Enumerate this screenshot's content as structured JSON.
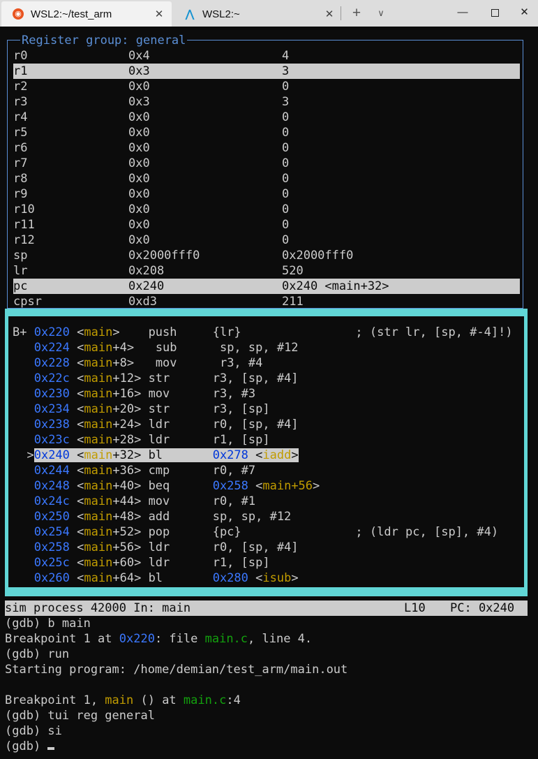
{
  "window": {
    "tabs": [
      {
        "title": "WSL2:~/test_arm",
        "close": "✕"
      },
      {
        "title": "WSL2:~",
        "close": "✕"
      }
    ],
    "new_tab": "+",
    "dropdown": "∨",
    "minimize": "—",
    "close": "✕"
  },
  "regs": {
    "title": "Register group: general",
    "rows": [
      {
        "name": "r0",
        "hex": "0x4",
        "val": "4"
      },
      {
        "name": "r1",
        "hex": "0x3",
        "val": "3"
      },
      {
        "name": "r2",
        "hex": "0x0",
        "val": "0"
      },
      {
        "name": "r3",
        "hex": "0x3",
        "val": "3"
      },
      {
        "name": "r4",
        "hex": "0x0",
        "val": "0"
      },
      {
        "name": "r5",
        "hex": "0x0",
        "val": "0"
      },
      {
        "name": "r6",
        "hex": "0x0",
        "val": "0"
      },
      {
        "name": "r7",
        "hex": "0x0",
        "val": "0"
      },
      {
        "name": "r8",
        "hex": "0x0",
        "val": "0"
      },
      {
        "name": "r9",
        "hex": "0x0",
        "val": "0"
      },
      {
        "name": "r10",
        "hex": "0x0",
        "val": "0"
      },
      {
        "name": "r11",
        "hex": "0x0",
        "val": "0"
      },
      {
        "name": "r12",
        "hex": "0x0",
        "val": "0"
      },
      {
        "name": "sp",
        "hex": "0x2000fff0",
        "val": "0x2000fff0"
      },
      {
        "name": "lr",
        "hex": "0x208",
        "val": "520"
      },
      {
        "name": "pc",
        "hex": "0x240",
        "val": "0x240 <main+32>"
      },
      {
        "name": "cpsr",
        "hex": "0xd3",
        "val": "211"
      }
    ]
  },
  "asm": {
    "rows": [
      {
        "prefix": "B+ ",
        "addr": "0x220",
        "sym": "main",
        "off": "",
        "pad": "   ",
        "op": "push",
        "args": "{lr}",
        "args_addr": "",
        "args_sym": "",
        "comment": "                ; (str lr, [sp, #-4]!)"
      },
      {
        "prefix": "   ",
        "addr": "0x224",
        "sym": "main",
        "off": "+4",
        "pad": " ",
        "op": "sub ",
        "args": "sp, sp, #12",
        "args_addr": "",
        "args_sym": "",
        "comment": ""
      },
      {
        "prefix": "   ",
        "addr": "0x228",
        "sym": "main",
        "off": "+8",
        "pad": " ",
        "op": "mov ",
        "args": "r3, #4",
        "args_addr": "",
        "args_sym": "",
        "comment": ""
      },
      {
        "prefix": "   ",
        "addr": "0x22c",
        "sym": "main",
        "off": "+12",
        "pad": "",
        "op": "str ",
        "args": "r3, [sp, #4]",
        "args_addr": "",
        "args_sym": "",
        "comment": ""
      },
      {
        "prefix": "   ",
        "addr": "0x230",
        "sym": "main",
        "off": "+16",
        "pad": "",
        "op": "mov ",
        "args": "r3, #3",
        "args_addr": "",
        "args_sym": "",
        "comment": ""
      },
      {
        "prefix": "   ",
        "addr": "0x234",
        "sym": "main",
        "off": "+20",
        "pad": "",
        "op": "str ",
        "args": "r3, [sp]",
        "args_addr": "",
        "args_sym": "",
        "comment": ""
      },
      {
        "prefix": "   ",
        "addr": "0x238",
        "sym": "main",
        "off": "+24",
        "pad": "",
        "op": "ldr ",
        "args": "r0, [sp, #4]",
        "args_addr": "",
        "args_sym": "",
        "comment": ""
      },
      {
        "prefix": "   ",
        "addr": "0x23c",
        "sym": "main",
        "off": "+28",
        "pad": "",
        "op": "ldr ",
        "args": "r1, [sp]",
        "args_addr": "",
        "args_sym": "",
        "comment": ""
      },
      {
        "prefix": "  >",
        "addr": "0x240",
        "sym": "main",
        "off": "+32",
        "pad": "",
        "op": "bl  ",
        "args": "",
        "args_addr": "0x278",
        "args_sym": "iadd",
        "comment": "",
        "current": true
      },
      {
        "prefix": "   ",
        "addr": "0x244",
        "sym": "main",
        "off": "+36",
        "pad": "",
        "op": "cmp ",
        "args": "r0, #7",
        "args_addr": "",
        "args_sym": "",
        "comment": ""
      },
      {
        "prefix": "   ",
        "addr": "0x248",
        "sym": "main",
        "off": "+40",
        "pad": "",
        "op": "beq ",
        "args": "",
        "args_addr": "0x258",
        "args_sym": "main+56",
        "comment": ""
      },
      {
        "prefix": "   ",
        "addr": "0x24c",
        "sym": "main",
        "off": "+44",
        "pad": "",
        "op": "mov ",
        "args": "r0, #1",
        "args_addr": "",
        "args_sym": "",
        "comment": ""
      },
      {
        "prefix": "   ",
        "addr": "0x250",
        "sym": "main",
        "off": "+48",
        "pad": "",
        "op": "add ",
        "args": "sp, sp, #12",
        "args_addr": "",
        "args_sym": "",
        "comment": ""
      },
      {
        "prefix": "   ",
        "addr": "0x254",
        "sym": "main",
        "off": "+52",
        "pad": "",
        "op": "pop ",
        "args": "{pc}",
        "args_addr": "",
        "args_sym": "",
        "comment": "                ; (ldr pc, [sp], #4)"
      },
      {
        "prefix": "   ",
        "addr": "0x258",
        "sym": "main",
        "off": "+56",
        "pad": "",
        "op": "ldr ",
        "args": "r0, [sp, #4]",
        "args_addr": "",
        "args_sym": "",
        "comment": ""
      },
      {
        "prefix": "   ",
        "addr": "0x25c",
        "sym": "main",
        "off": "+60",
        "pad": "",
        "op": "ldr ",
        "args": "r1, [sp]",
        "args_addr": "",
        "args_sym": "",
        "comment": ""
      },
      {
        "prefix": "   ",
        "addr": "0x260",
        "sym": "main",
        "off": "+64",
        "pad": "",
        "op": "bl  ",
        "args": "",
        "args_addr": "0x280",
        "args_sym": "isub",
        "comment": ""
      }
    ]
  },
  "status": {
    "process": "sim process 42000 In: main",
    "line": "L10",
    "pc": "PC: 0x240"
  },
  "console": {
    "l1": "(gdb) b main",
    "l2_a": "Breakpoint 1 at ",
    "l2_addr": "0x220",
    "l2_b": ": file ",
    "l2_file": "main.c",
    "l2_c": ", line 4.",
    "l3": "(gdb) run",
    "l4": "Starting program: /home/demian/test_arm/main.out",
    "l6_a": "Breakpoint 1, ",
    "l6_func": "main",
    "l6_b": " () at ",
    "l6_file": "main.c",
    "l6_c": ":4",
    "l7": "(gdb) tui reg general",
    "l8": "(gdb) si",
    "l9": "(gdb) "
  }
}
